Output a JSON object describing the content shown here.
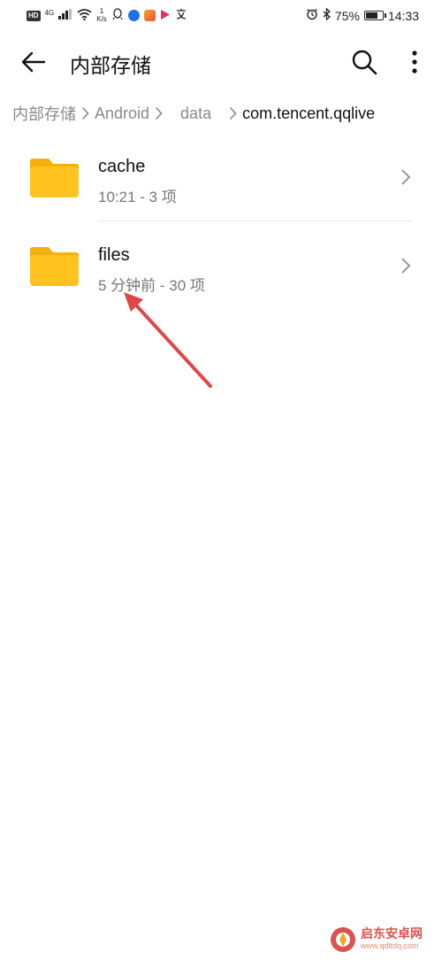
{
  "status_bar": {
    "hd": "HD",
    "network": "4G",
    "net_speed_value": "1",
    "net_speed_unit": "K/s",
    "battery_percent": "75%",
    "battery_level": 0.75,
    "time": "14:33"
  },
  "header": {
    "title": "内部存储"
  },
  "breadcrumb": {
    "items": [
      "内部存储",
      "Android",
      "data",
      "com.tencent.qqlive"
    ]
  },
  "list": {
    "items": [
      {
        "name": "cache",
        "meta": "10:21 - 3 项"
      },
      {
        "name": "files",
        "meta": "5 分钟前 - 30 项"
      }
    ]
  },
  "watermark": {
    "title": "启东安卓网",
    "url": "www.qdltdq.com"
  },
  "colors": {
    "folder": "#FFC21F",
    "folder_tab": "#F5B010",
    "annotation_arrow": "#E04848",
    "watermark": "#D9534F"
  }
}
